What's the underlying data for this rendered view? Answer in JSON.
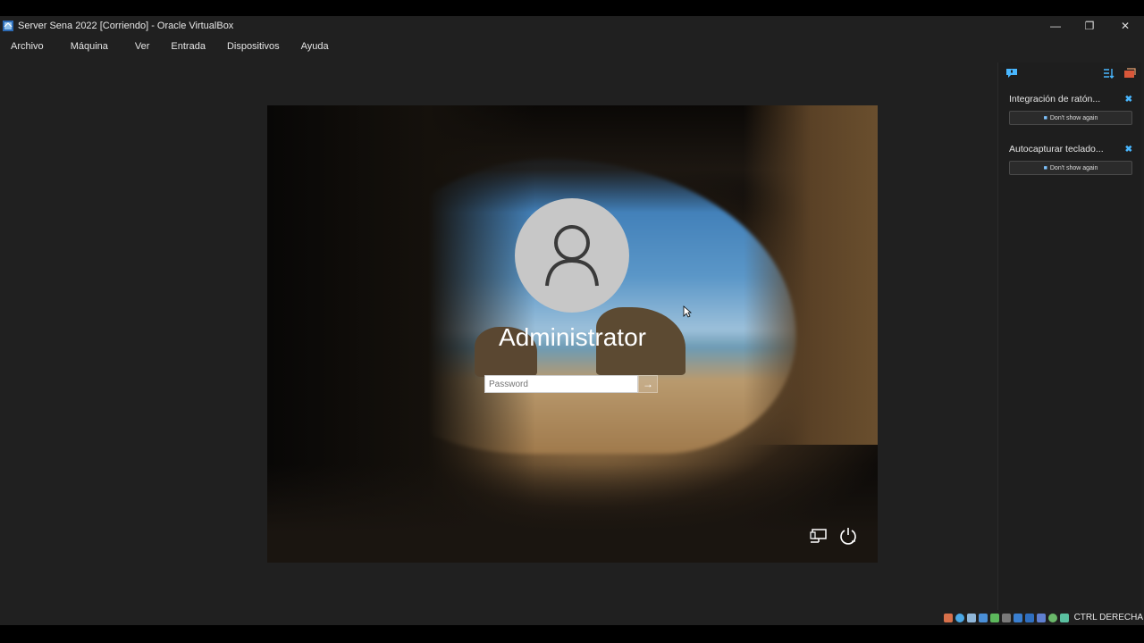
{
  "window": {
    "title": "Server Sena 2022 [Corriendo] - Oracle VirtualBox",
    "minimize_glyph": "—",
    "restore_glyph": "❐",
    "close_glyph": "✕"
  },
  "menu": {
    "items": [
      {
        "label": "Archivo"
      },
      {
        "label": "Máquina"
      },
      {
        "label": "Ver"
      },
      {
        "label": "Entrada"
      },
      {
        "label": "Dispositivos"
      },
      {
        "label": "Ayuda"
      }
    ]
  },
  "login": {
    "username": "Administrator",
    "password_placeholder": "Password",
    "submit_glyph": "→"
  },
  "notices": {
    "items": [
      {
        "title": "Integración de ratón...",
        "button": "Don't show again"
      },
      {
        "title": "Autocapturar teclado...",
        "button": "Don't show again"
      }
    ],
    "close_glyph": "✖"
  },
  "statusbar": {
    "host_key": "CTRL DERECHA",
    "icons": [
      "hard-disk-icon",
      "optical-drive-icon",
      "audio-icon",
      "network-icon",
      "usb-icon",
      "shared-folders-icon",
      "display-icon",
      "video-capture-icon",
      "virtualization-icon",
      "cpu-icon",
      "mouse-integration-icon"
    ]
  },
  "colors": {
    "accent": "#49b7ff",
    "chrome_bg": "#202020"
  }
}
